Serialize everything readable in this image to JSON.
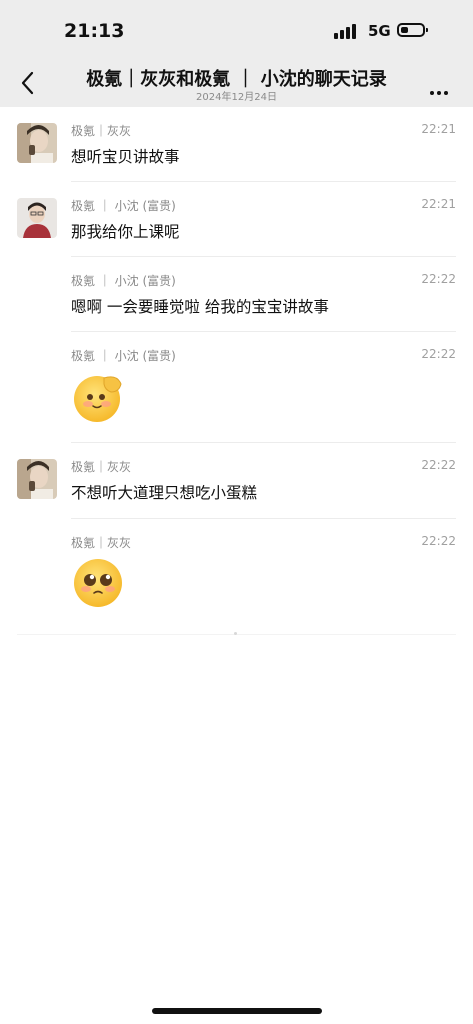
{
  "status_bar": {
    "time": "21:13",
    "network": "5G"
  },
  "nav": {
    "title": "极氪｜灰灰和极氪 ｜ 小沈的聊天记录",
    "subtitle": "2024年12月24日"
  },
  "messages": [
    {
      "sender": "极氪｜灰灰",
      "time": "22:21",
      "text": "想听宝贝讲故事"
    },
    {
      "sender": "极氪 ｜ 小沈 (富贵)",
      "time": "22:21",
      "text": "那我给你上课呢"
    },
    {
      "sender": "极氪 ｜ 小沈 (富贵)",
      "time": "22:22",
      "text": "嗯啊 一会要睡觉啦 给我的宝宝讲故事"
    },
    {
      "sender": "极氪 ｜ 小沈 (富贵)",
      "time": "22:22",
      "sticker": "salute-emoji-icon"
    },
    {
      "sender": "极氪｜灰灰",
      "time": "22:22",
      "text": "不想听大道理只想吃小蛋糕"
    },
    {
      "sender": "极氪｜灰灰",
      "time": "22:22",
      "sticker": "pleading-emoji-icon"
    }
  ]
}
